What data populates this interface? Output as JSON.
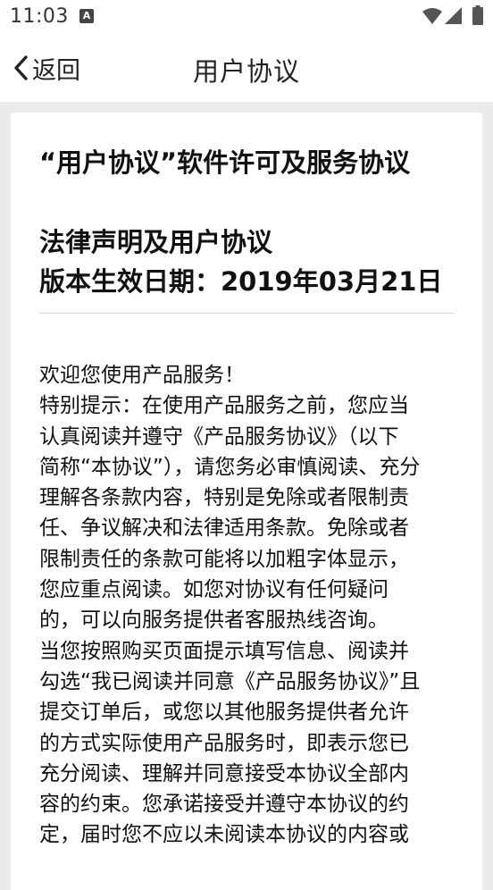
{
  "status_bar": {
    "time": "11:03",
    "notification_icon": "a-letter-icon",
    "wifi_icon": "wifi-icon",
    "signal_icon": "signal-icon",
    "battery_icon": "battery-icon"
  },
  "nav": {
    "back_label": "返回",
    "title": "用户协议"
  },
  "document": {
    "title": "“用户协议”软件许可及服务协议",
    "subtitle": "法律声明及用户协议",
    "effective_date": "版本生效日期：2019年03月21日",
    "lines": [
      "欢迎您使用产品服务！",
      "特别提示：在使用产品服务之前，您应当",
      "认真阅读并遵守《产品服务协议》（以下",
      "简称“本协议”），请您务必审慎阅读、充分",
      "理解各条款内容，特别是免除或者限制责",
      "任、争议解决和法律适用条款。免除或者",
      "限制责任的条款可能将以加粗字体显示，",
      "您应重点阅读。如您对协议有任何疑问",
      "的，可以向服务提供者客服热线咨询。",
      "当您按照购买页面提示填写信息、阅读并",
      "勾选“我已阅读并同意《产品服务协议》”且",
      "提交订单后，或您以其他服务提供者允许",
      "的方式实际使用产品服务时，即表示您已",
      "充分阅读、理解并同意接受本协议全部内",
      "容的约束。您承诺接受并遵守本协议的约",
      "定，届时您不应以未阅读本协议的内容或"
    ]
  },
  "colors": {
    "page_background": "#ebebeb",
    "surface": "#ffffff",
    "text": "#111111"
  }
}
